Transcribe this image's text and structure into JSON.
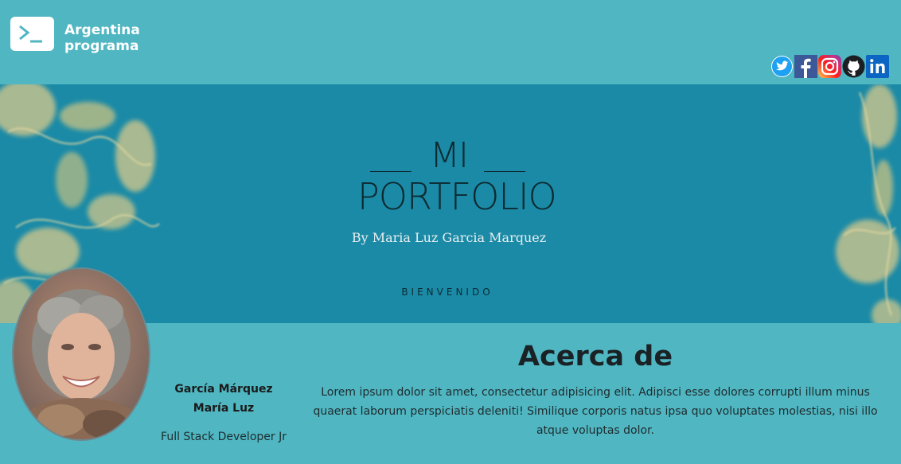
{
  "brand": {
    "line1": "Argentina",
    "line2": "programa"
  },
  "social": [
    {
      "icon": "twitter-icon",
      "color": "#1da1f2"
    },
    {
      "icon": "facebook-icon",
      "color": "#3b5998"
    },
    {
      "icon": "instagram-icon",
      "color": "#d6249f"
    },
    {
      "icon": "github-icon",
      "color": "#1b1f23"
    },
    {
      "icon": "linkedin-icon",
      "color": "#0a66c2"
    }
  ],
  "banner": {
    "mi": "MI",
    "portfolio": "PORTFOLIO",
    "byline": "By Maria Luz Garcia Marquez",
    "welcome": "BIENVENIDO"
  },
  "profile": {
    "surname": "García Márquez",
    "name": "María Luz",
    "role": "Full Stack Developer Jr"
  },
  "about": {
    "title": "Acerca de",
    "text": "Lorem ipsum dolor sit amet, consectetur adipisicing elit. Adipisci esse dolores corrupti illum minus quaerat laborum perspiciatis deleniti! Similique corporis natus ipsa quo voluptates molestias, nisi illo atque voluptas dolor."
  },
  "colors": {
    "header": "#4fb6c2",
    "banner": "#1b8aa6",
    "smoke": "#d9c98a"
  }
}
